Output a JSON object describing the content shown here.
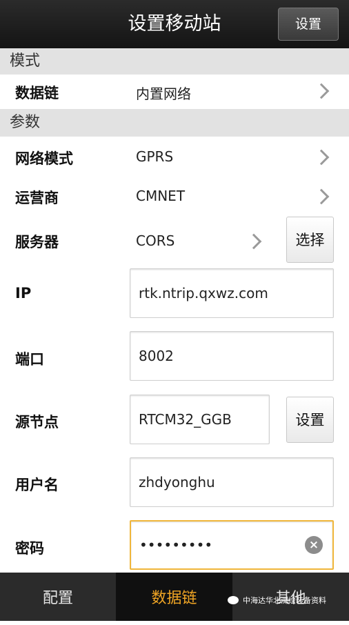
{
  "header": {
    "title": "设置移动站",
    "settings_button": "设置"
  },
  "mode_section": {
    "header": "模式",
    "datalink": {
      "label": "数据链",
      "value": "内置网络"
    }
  },
  "params_section": {
    "header": "参数",
    "network_mode": {
      "label": "网络模式",
      "value": "GPRS"
    },
    "operator": {
      "label": "运营商",
      "value": "CMNET"
    },
    "server": {
      "label": "服务器",
      "value": "CORS",
      "select_button": "选择"
    },
    "ip": {
      "label": "IP",
      "value": "rtk.ntrip.qxwz.com"
    },
    "port": {
      "label": "端口",
      "value": "8002"
    },
    "source_node": {
      "label": "源节点",
      "value": "RTCM32_GGB",
      "set_button": "设置"
    },
    "username": {
      "label": "用户名",
      "value": "zhdyonghu"
    },
    "password": {
      "label": "密码",
      "value": "•••••••••"
    }
  },
  "bottom_tabs": [
    {
      "label": "配置",
      "active": false
    },
    {
      "label": "数据链",
      "active": true
    },
    {
      "label": "其他",
      "active": false
    }
  ],
  "watermark": {
    "text": "中海达华北测绘装备资料"
  },
  "colors": {
    "accent": "#f0a524",
    "focus_border": "#f0b63a"
  }
}
